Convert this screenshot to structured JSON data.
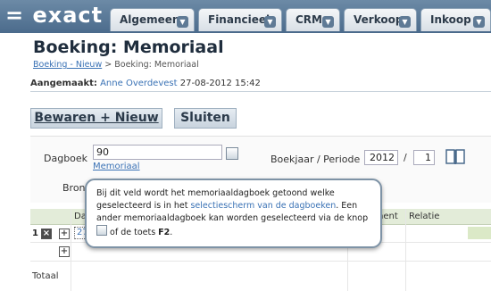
{
  "app": {
    "logo": "= exact"
  },
  "nav": {
    "tabs": [
      {
        "label": "Algemeen"
      },
      {
        "label": "Financieel"
      },
      {
        "label": "CRM"
      },
      {
        "label": "Verkoop"
      },
      {
        "label": "Inkoop"
      }
    ]
  },
  "page": {
    "title": "Boeking: Memoriaal",
    "breadcrumb": {
      "link": "Boeking - Nieuw",
      "separator": ">",
      "current": "Boeking: Memoriaal"
    },
    "created": {
      "label": "Aangemaakt:",
      "user": "Anne Overdevest",
      "datetime": "27-08-2012 15:42"
    }
  },
  "toolbar": {
    "save_new_label": "Bewaren + Nieuw",
    "close_label": "Sluiten"
  },
  "form": {
    "dagboek_label": "Dagboek",
    "dagboek_value": "90",
    "dagboek_name": "Memoriaal",
    "boekjaar_label": "Boekjaar / Periode",
    "year": "2012",
    "period_sep": "/",
    "period": "1",
    "bron_label": "Bron"
  },
  "grid": {
    "headers": {
      "date": "Datum",
      "document": "Document",
      "relation": "Relatie"
    },
    "row1_number": "1",
    "row1_date_partial": "27",
    "total_label": "Totaal"
  },
  "tooltip": {
    "line1": "Bij dit veld wordt het memoriaaldagboek getoond welke geselecteerd is in het ",
    "link": "selectiescherm van de dagboeken",
    "line2": ". Een ander memoriaaldagboek kan worden geselecteerd via de knop ",
    "line3": " of de toets ",
    "key": "F2",
    "end": "."
  },
  "colors": {
    "accent_link": "#3a72b5",
    "topbar": "#4b6b8c",
    "grid_header": "#e3ecd9"
  }
}
